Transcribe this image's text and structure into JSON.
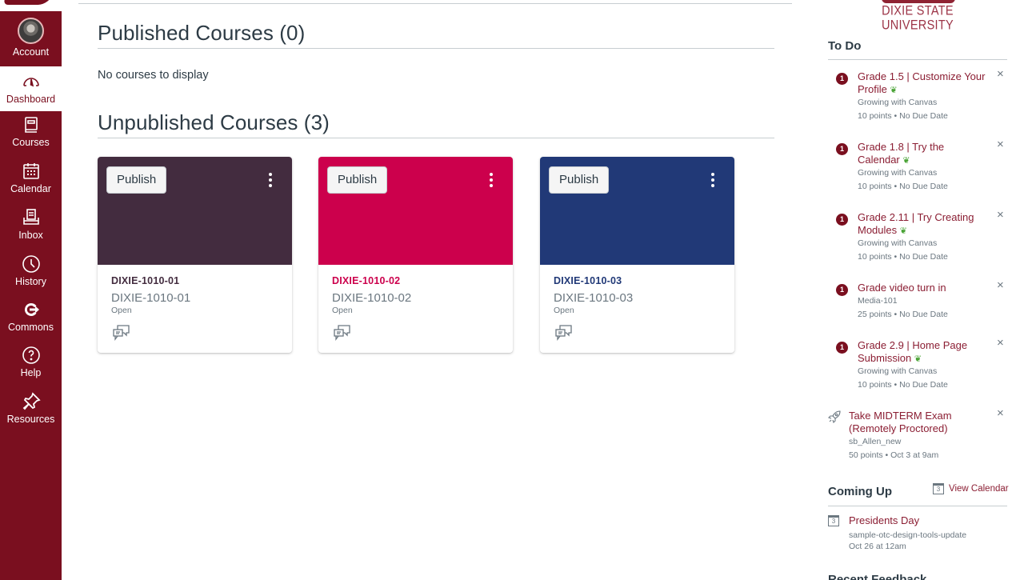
{
  "nav": {
    "items": [
      {
        "label": "Account",
        "icon": "avatar"
      },
      {
        "label": "Dashboard",
        "icon": "dashboard-gauge-icon"
      },
      {
        "label": "Courses",
        "icon": "courses-book-icon"
      },
      {
        "label": "Calendar",
        "icon": "calendar-icon"
      },
      {
        "label": "Inbox",
        "icon": "inbox-icon"
      },
      {
        "label": "History",
        "icon": "clock-icon"
      },
      {
        "label": "Commons",
        "icon": "commons-icon"
      },
      {
        "label": "Help",
        "icon": "help-icon"
      },
      {
        "label": "Resources",
        "icon": "pushpin-icon"
      }
    ],
    "active": "Dashboard",
    "brand_color": "#7a0f1f"
  },
  "main": {
    "published": {
      "title": "Published Courses (0)",
      "empty_message": "No courses to display"
    },
    "unpublished": {
      "title": "Unpublished Courses (3)",
      "cards": [
        {
          "name": "DIXIE-1010-01",
          "code": "DIXIE-1010-01",
          "term": "Open",
          "color": "#432c3f",
          "publish_label": "Publish"
        },
        {
          "name": "DIXIE-1010-02",
          "code": "DIXIE-1010-02",
          "term": "Open",
          "color": "#cc004c",
          "publish_label": "Publish"
        },
        {
          "name": "DIXIE-1010-03",
          "code": "DIXIE-1010-03",
          "term": "Open",
          "color": "#213977",
          "publish_label": "Publish"
        }
      ]
    }
  },
  "sidebar": {
    "brand": "DIXIE STATE UNIVERSITY",
    "todo_title": "To Do",
    "todo": [
      {
        "title": "Grade 1.5 | Customize Your Profile",
        "leaf": true,
        "badge": "1",
        "course": "Growing with Canvas",
        "details": "10 points • No Due Date"
      },
      {
        "title": "Grade 1.8 | Try the Calendar",
        "leaf": true,
        "badge": "1",
        "course": "Growing with Canvas",
        "details": "10 points • No Due Date"
      },
      {
        "title": "Grade 2.11 | Try Creating Modules",
        "leaf": true,
        "badge": "1",
        "course": "Growing with Canvas",
        "details": "10 points • No Due Date"
      },
      {
        "title": "Grade video turn in",
        "leaf": false,
        "badge": "1",
        "course": "Media-101",
        "details": "25 points • No Due Date"
      },
      {
        "title": "Grade 2.9 | Home Page Submission",
        "leaf": true,
        "badge": "1",
        "course": "Growing with Canvas",
        "details": "10 points • No Due Date"
      },
      {
        "title": "Take MIDTERM Exam (Remotely Proctored)",
        "leaf": false,
        "icon": "rocket-icon",
        "course": "sb_Allen_new",
        "details": "50 points • Oct 3 at 9am"
      }
    ],
    "coming_up_title": "Coming Up",
    "view_calendar": "View Calendar",
    "calendar_day": "3",
    "events": [
      {
        "title": "Presidents Day",
        "context": "sample-otc-design-tools-update",
        "date": "Oct 26 at 12am"
      }
    ],
    "recent_feedback_title": "Recent Feedback",
    "leaf_glyph": "❦",
    "close_glyph": "×"
  }
}
